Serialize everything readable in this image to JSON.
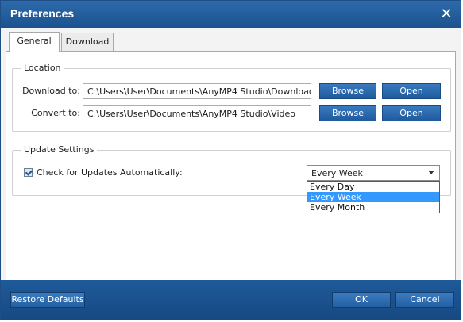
{
  "window": {
    "title": "Preferences"
  },
  "tabs": [
    {
      "label": "General",
      "active": true
    },
    {
      "label": "Download",
      "active": false
    }
  ],
  "location": {
    "legend": "Location",
    "download": {
      "label": "Download to:",
      "value": "C:\\Users\\User\\Documents\\AnyMP4 Studio\\Download",
      "browse_label": "Browse",
      "open_label": "Open"
    },
    "convert": {
      "label": "Convert to:",
      "value": "C:\\Users\\User\\Documents\\AnyMP4 Studio\\Video",
      "browse_label": "Browse",
      "open_label": "Open"
    }
  },
  "update": {
    "legend": "Update Settings",
    "check_label": "Check for Updates Automatically:",
    "checked": true,
    "frequency_selected": "Every Week",
    "frequency_options": [
      "Every Day",
      "Every Week",
      "Every Month"
    ]
  },
  "footer": {
    "restore_label": "Restore Defaults",
    "ok_label": "OK",
    "cancel_label": "Cancel"
  },
  "colors": {
    "accent": "#1c528f",
    "button": "#2a68ad",
    "selection": "#3399ff"
  }
}
